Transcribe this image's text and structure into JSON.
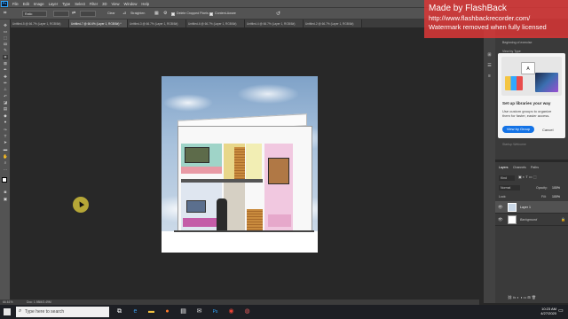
{
  "app": {
    "logo": "Ps",
    "menu": [
      "File",
      "Edit",
      "Image",
      "Layer",
      "Type",
      "Select",
      "Filter",
      "3D",
      "View",
      "Window",
      "Help"
    ]
  },
  "options_bar": {
    "mode_value": "Ratio",
    "clear_label": "Clear",
    "straighten_label": "Straighten",
    "delete_cropped_label": "Delete Cropped Pixels",
    "content_aware_label": "Content-Aware"
  },
  "tabs": [
    {
      "label": "Untitled-5 @ 66.7% (Layer 1, RGB/8#)",
      "active": false
    },
    {
      "label": "Untitled-7 @ 66.6% (Layer 1, RGB/8#) *",
      "active": true
    },
    {
      "label": "Untitled-3 @ 66.7% (Layer 1, RGB/8#)",
      "active": false
    },
    {
      "label": "Untitled-6 @ 66.7% (Layer 1, RGB/8#)",
      "active": false
    },
    {
      "label": "Untitled-4 @ 66.7% (Layer 1, RGB/8#)",
      "active": false
    },
    {
      "label": "Untitled-2 @ 66.7% (Layer 1, RGB/8#)",
      "active": false
    }
  ],
  "tools": [
    "move-tool-icon",
    "artboard-icon",
    "marquee-icon",
    "lasso-icon",
    "quick-select-icon",
    "crop-icon",
    "frame-icon",
    "eyedropper-icon",
    "healing-icon",
    "brush-icon",
    "stamp-icon",
    "history-brush-icon",
    "eraser-icon",
    "gradient-icon",
    "blur-icon",
    "dodge-icon",
    "pen-icon",
    "type-icon",
    "path-select-icon",
    "shape-icon",
    "hand-icon",
    "zoom-icon",
    "more-icon"
  ],
  "status": {
    "zoom": "66.61%",
    "doc_size": "Doc: 1.98M/3.49M"
  },
  "libraries": {
    "header": "Beginning of exercise",
    "view_by": "View by Type",
    "popup_title": "Set up libraries your way",
    "popup_body": "Use custom groups to organize them for faster, easier access.",
    "view_by_group_button": "View by Group",
    "cancel_button": "Cancel",
    "footer": "Startup Welcome"
  },
  "layers_panel": {
    "tabs": [
      "Layers",
      "Channels",
      "Paths"
    ],
    "kind": "Kind",
    "blend_mode": "Normal",
    "opacity_label": "Opacity:",
    "opacity": "100%",
    "lock_label": "Lock:",
    "fill_label": "Fill:",
    "fill": "100%",
    "layers": [
      {
        "name": "Layer 1",
        "selected": true
      },
      {
        "name": "Background",
        "selected": false
      }
    ]
  },
  "watermark": {
    "title": "Made by FlashBack",
    "url": "http://www.flashbackrecorder.com/",
    "note": "Watermark removed when fully licensed"
  },
  "taskbar": {
    "search_placeholder": "Type here to search",
    "apps": [
      "task-view-icon",
      "edge-icon",
      "explorer-icon",
      "firefox-icon",
      "store-icon",
      "mail-icon",
      "photoshop-icon",
      "chrome-icon",
      "recorder-icon"
    ],
    "time": "10:23 AM",
    "date": "4/27/2020"
  },
  "colors": {
    "ps_blue": "#31a8ff",
    "watermark_red": "#dc3737",
    "popup_button": "#1473e6"
  }
}
